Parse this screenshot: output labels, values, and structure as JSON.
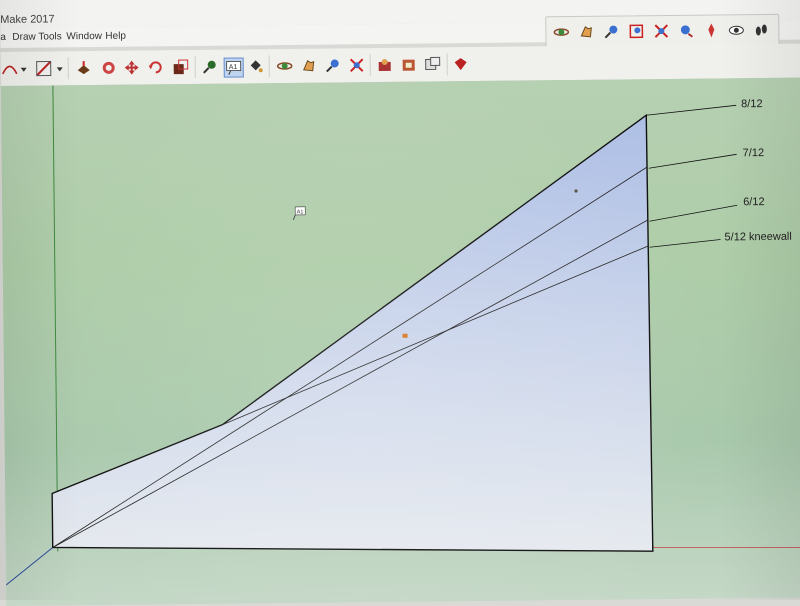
{
  "window": {
    "title": "Make 2017"
  },
  "menu": [
    "a",
    "Draw",
    "Tools",
    "Window",
    "Help"
  ],
  "toolbar_top": {
    "icons": [
      "orbit-icon",
      "pan-icon",
      "zoom-icon",
      "zoom-window-icon",
      "zoom-extents-icon",
      "previous-view-icon",
      "position-camera-icon",
      "look-around-icon",
      "walk-icon"
    ]
  },
  "toolbar_main": {
    "icons": [
      "arc-icon",
      "shape-icon",
      "push-pull-icon",
      "follow-me-icon",
      "move-icon",
      "rotate-icon",
      "scale-icon",
      "tape-measure-icon",
      "text-icon",
      "paint-bucket-icon",
      "orbit-icon",
      "pan-icon",
      "zoom-icon",
      "zoom-extents-icon",
      "warehouse-icon",
      "extension-warehouse-icon",
      "layout-icon",
      "ruby-icon"
    ]
  },
  "drawing": {
    "cursor_text": "A1",
    "labels": [
      "8/12",
      "7/12",
      "6/12",
      "5/12 kneewall"
    ],
    "face_color_top": "#aebfe6",
    "face_color_bottom": "#e6eaef"
  }
}
